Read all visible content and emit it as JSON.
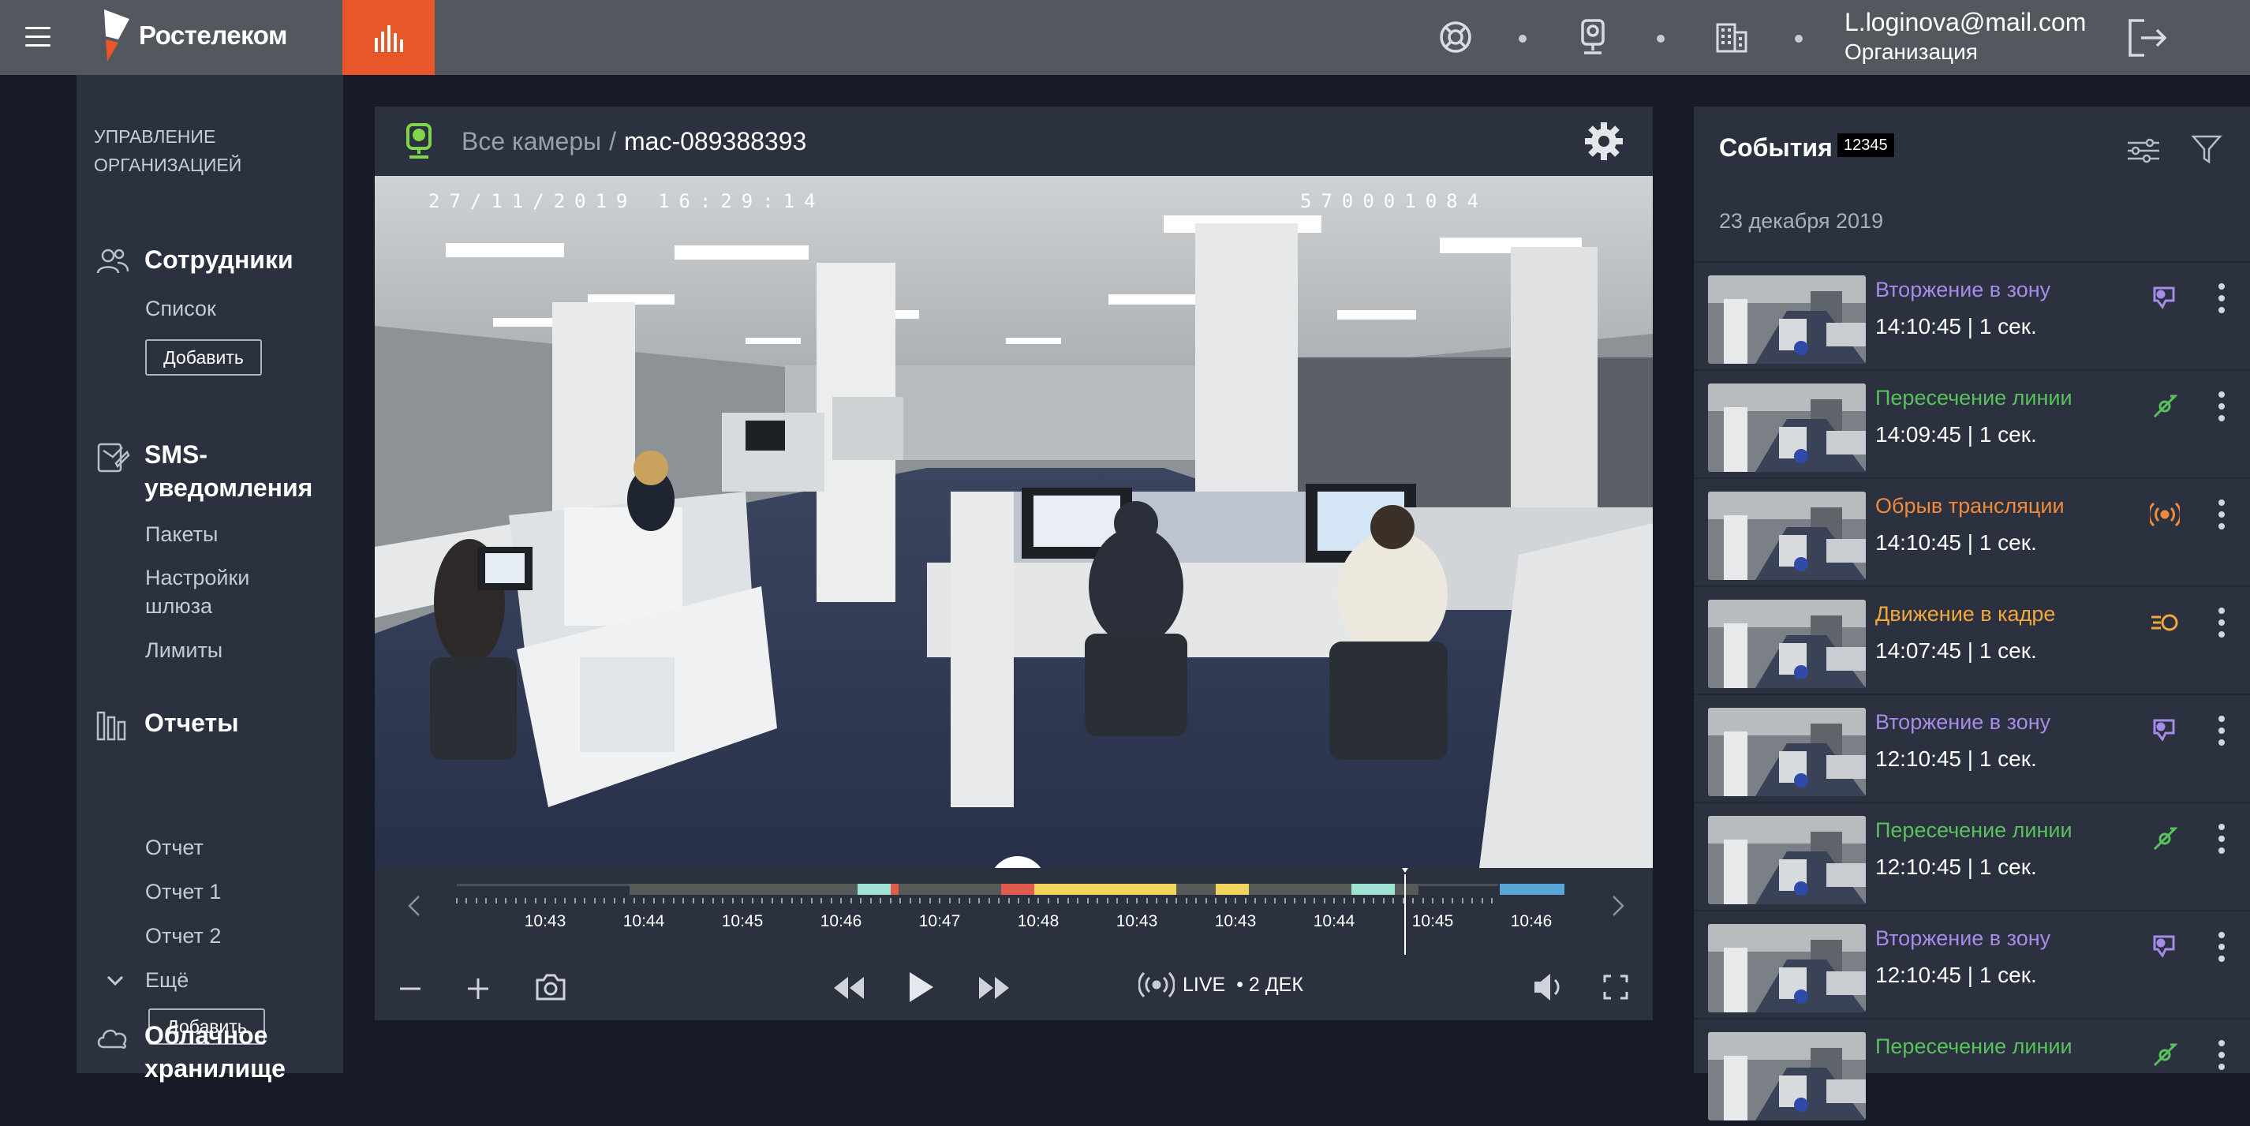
{
  "topbar": {
    "brand": "Ростелеком",
    "icons": [
      "menu-icon",
      "logo-icon",
      "stats-icon",
      "support-icon",
      "camera-icon",
      "building-icon",
      "logout-icon"
    ],
    "user_email": "L.loginova@mail.com",
    "user_org": "Организация"
  },
  "sidebar": {
    "caption_line1": "УПРАВЛЕНИЕ",
    "caption_line2": "ОРГАНИЗАЦИЕЙ",
    "employees": {
      "title": "Сотрудники",
      "items": [
        "Список"
      ],
      "add_label": "Добавить"
    },
    "sms": {
      "title_line1": "SMS-",
      "title_line2": "уведомления",
      "items": [
        "Пакеты",
        "Настройки",
        "шлюза",
        "Лимиты"
      ]
    },
    "reports": {
      "title": "Отчеты",
      "items": [
        "Отчет",
        "Отчет 1",
        "Отчет 2"
      ],
      "more_label": "Ещё",
      "add_label": "Добавить"
    },
    "cloud": {
      "title_line1": "Облачное",
      "title_line2": "хранилище"
    }
  },
  "player": {
    "breadcrumb_root": "Все камеры",
    "breadcrumb_sep": "/",
    "camera_name": "mac-089388393",
    "osd_datetime": "27/11/2019 16:29:14",
    "osd_id": "570001084",
    "timeline_labels": [
      "10:43",
      "10:44",
      "10:45",
      "10:46",
      "10:47",
      "10:48",
      "10:43",
      "10:43",
      "10:44",
      "10:45",
      "10:46"
    ],
    "live_label": "LIVE",
    "live_date": "• 2 ДЕК",
    "colors": {
      "accent": "#e8562a",
      "motion": "#f3a83a",
      "line": "#59c15d",
      "zone": "#a78be8",
      "error": "#e05a4e",
      "teal": "#9fe3d3",
      "yellow": "#f2d55b",
      "blue": "#5aa6d8"
    }
  },
  "events": {
    "title": "События",
    "count": "12345",
    "date": "23 декабря 2019",
    "items": [
      {
        "name": "Вторжение в зону",
        "time": "14:10:45 | 1 сек.",
        "color": "#a78be8",
        "icon": "zone-intrusion-icon"
      },
      {
        "name": "Пересечение линии",
        "time": "14:09:45 | 1 сек.",
        "color": "#59c15d",
        "icon": "line-crossing-icon"
      },
      {
        "name": "Обрыв трансляции",
        "time": "14:10:45 | 1 сек.",
        "color": "#f08a3c",
        "icon": "stream-loss-icon"
      },
      {
        "name": "Движение в кадре",
        "time": "14:07:45 | 1 сек.",
        "color": "#f3a83a",
        "icon": "motion-icon"
      },
      {
        "name": "Вторжение в зону",
        "time": "12:10:45 | 1 сек.",
        "color": "#a78be8",
        "icon": "zone-intrusion-icon"
      },
      {
        "name": "Пересечение линии",
        "time": "12:10:45 | 1 сек.",
        "color": "#59c15d",
        "icon": "line-crossing-icon"
      },
      {
        "name": "Вторжение в зону",
        "time": "12:10:45 | 1 сек.",
        "color": "#a78be8",
        "icon": "zone-intrusion-icon"
      },
      {
        "name": "Пересечение линии",
        "time": "",
        "color": "#59c15d",
        "icon": "line-crossing-icon"
      }
    ]
  }
}
